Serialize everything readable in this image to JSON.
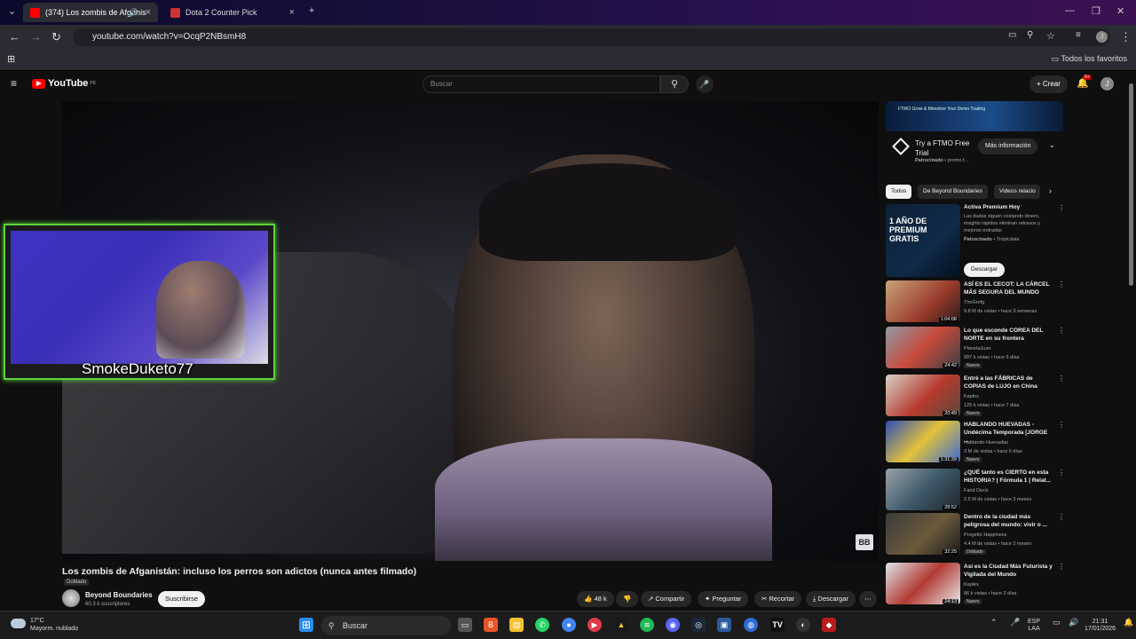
{
  "browser": {
    "tabs": [
      {
        "label": "(374) Los zombis de Afganis",
        "active": true
      },
      {
        "label": "Dota 2 Counter Pick",
        "active": false
      }
    ],
    "url": "youtube.com/watch?v=OcqP2NBsmH8",
    "bookmarks_folder": "Todos los favoritos"
  },
  "youtube": {
    "logo": "YouTube",
    "region": "PE",
    "search_placeholder": "Buscar",
    "create_label": "Crear",
    "notifications": "9+",
    "avatar_letter": "J"
  },
  "video": {
    "title": "Los zombis de Afganistán: incluso los perros son adictos (nunca antes filmado)",
    "dubbed_label": "Doblado",
    "channel": "Beyond Boundaries",
    "subscribers": "60.3 k suscriptores",
    "subscribe_label": "Suscribirse",
    "likes": "48 k",
    "share_label": "Compartir",
    "ask_label": "Preguntar",
    "clip_label": "Recortar",
    "download_label": "Descargar",
    "watermark": "BB"
  },
  "overlay": {
    "streamer_name": "SmokeDuketo77"
  },
  "sidebar": {
    "ad": {
      "banner_text": "FTMO Grow & Monetize Your Demo Trading",
      "title": "Try a FTMO Free Trial",
      "sponsored": "Patrocinado",
      "domain": "promo.f...",
      "more_info": "Más información"
    },
    "chips": [
      "Todos",
      "De Beyond Boundaries",
      "Videos relacio"
    ],
    "promo": {
      "thumb_text": "1 AÑO DE PREMIUM GRATIS",
      "title": "Activa Premium Hoy",
      "description": "Las dudas siguen costando dinero, insights rápidos eliminan retrasos y mejoran entradas",
      "sponsored": "Patrocinado",
      "advertiser": "Tropicdata",
      "button": "Descargar"
    },
    "videos": [
      {
        "title": "ASÍ ES EL CECOT: LA CÁRCEL MÁS SEGURA DEL MUNDO",
        "channel": "TheGrefg",
        "meta": "9.8 M de vistas • hace 3 semanas",
        "duration": "1:04:08",
        "badge": ""
      },
      {
        "title": "Lo que esconde COREA DEL NORTE en su frontera",
        "channel": "PlanetaJuan",
        "meta": "997 k vistas • hace 6 días",
        "duration": "24:42",
        "badge": "Nuevo"
      },
      {
        "title": "Entré a las FÁBRICAS de COPIAS de LUJO en China",
        "channel": "Kaplex",
        "meta": "125 k vistas • hace 7 días",
        "duration": "20:49",
        "badge": "Nuevo"
      },
      {
        "title": "HABLANDO HUEVADAS - Undécima Temporada [JORGE ...",
        "channel": "Hablando Huevadas",
        "meta": "3 M de vistas • hace 6 días",
        "duration": "1:31:39",
        "badge": "Nuevo"
      },
      {
        "title": "¿QUÉ tanto es CIERTO en esta HISTORIA? | Fórmula 1 | Relat...",
        "channel": "Farid Dieck",
        "meta": "2.5 M de vistas • hace 3 meses",
        "duration": "28:52",
        "badge": ""
      },
      {
        "title": "Dentro de la ciudad más peligrosa del mundo: vivir o ...",
        "channel": "Progetto Happiness",
        "meta": "4.4 M de vistas • hace 2 meses",
        "duration": "32:25",
        "badge": "Doblado"
      },
      {
        "title": "Así es la Ciudad Más Futurista y Vigilada del Mundo",
        "channel": "Kaplex",
        "meta": "86 k vistas • hace 3 días",
        "duration": "24:13",
        "badge": "Nuevo"
      }
    ]
  },
  "taskbar": {
    "weather_temp": "17°C",
    "weather_desc": "Mayorm. nublado",
    "search_label": "Buscar",
    "lang_top": "ESP",
    "lang_bottom": "LAA",
    "time": "21:31",
    "date": "17/01/2026"
  },
  "colors": {
    "youtube_red": "#ff0000",
    "overlay_green": "#5fd33a",
    "background": "#0f0f0f"
  }
}
